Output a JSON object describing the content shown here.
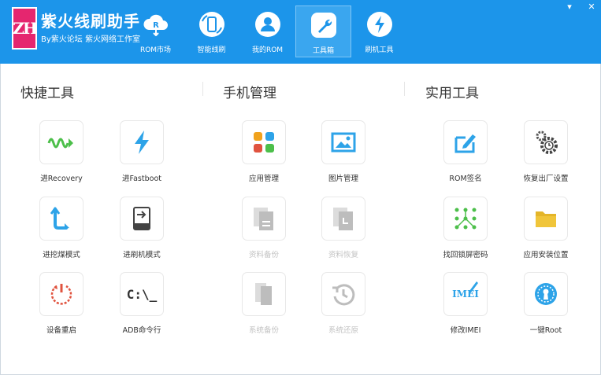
{
  "brand": {
    "logo_text": "ZH",
    "title": "紫火线刷助手",
    "subtitle": "By紫火论坛 紫火网络工作室"
  },
  "nav": [
    {
      "label": "ROM市场",
      "icon": "cloud-rom-icon"
    },
    {
      "label": "智能线刷",
      "icon": "phone-refresh-icon"
    },
    {
      "label": "我的ROM",
      "icon": "user-icon"
    },
    {
      "label": "工具箱",
      "icon": "wrench-icon",
      "active": true
    },
    {
      "label": "刷机工具",
      "icon": "lightning-icon"
    }
  ],
  "window": {
    "minimize": "▾",
    "close": "✕"
  },
  "sections": {
    "quick": "快捷工具",
    "phone": "手机管理",
    "utility": "实用工具"
  },
  "tools": {
    "recovery": "进Recovery",
    "fastboot": "进Fastboot",
    "dig_mode": "进挖煤模式",
    "flash_mode": "进刷机模式",
    "reboot": "设备重启",
    "adb": "ADB命令行",
    "adb_glyph": "C:\\_",
    "app_manage": "应用管理",
    "pic_manage": "图片管理",
    "data_backup": "资料备份",
    "data_restore": "资料恢复",
    "sys_backup": "系统备份",
    "sys_restore": "系统还原",
    "rom_sign": "ROM签名",
    "factory_reset": "恢复出厂设置",
    "unlock_pattern": "找回锁屏密码",
    "app_location": "应用安装位置",
    "imei_edit": "修改IMEI",
    "imei_glyph": "IMEI",
    "root": "一键Root"
  },
  "colors": {
    "header": "#1c95ea",
    "logo": "#e5266f",
    "green": "#4cbf4a",
    "blue": "#2da3e8",
    "red": "#e0533f",
    "orange": "#f0a21d",
    "gray_disabled": "#c8c8c8"
  }
}
